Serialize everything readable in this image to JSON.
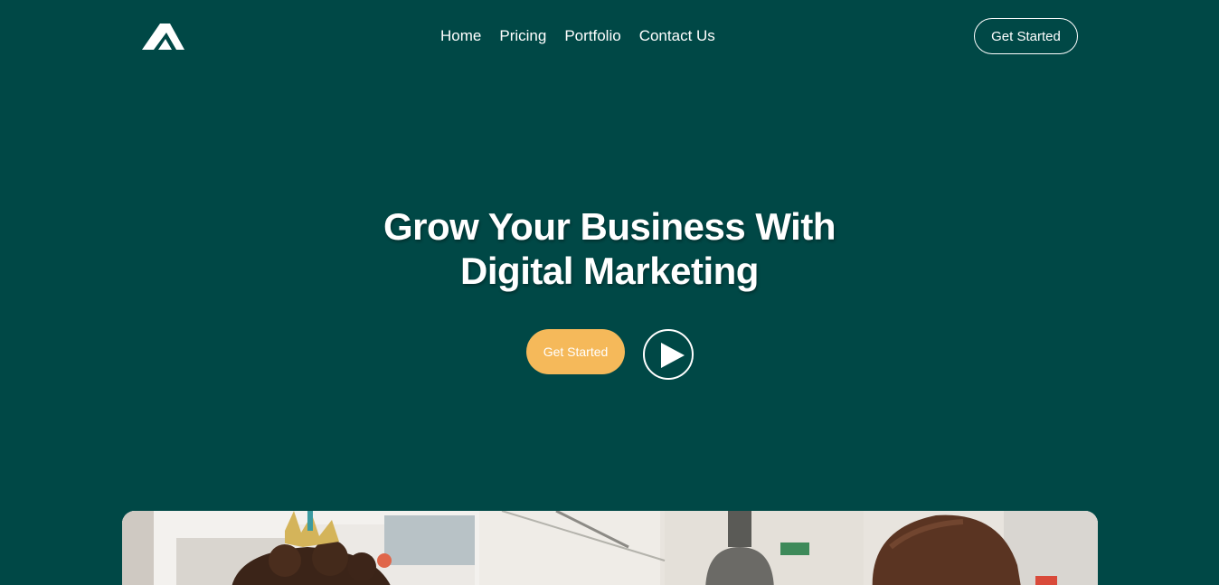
{
  "header": {
    "logo_icon": "triangle-a-logo",
    "nav": [
      {
        "label": "Home"
      },
      {
        "label": "Pricing"
      },
      {
        "label": "Portfolio"
      },
      {
        "label": "Contact Us"
      }
    ],
    "cta_label": "Get Started"
  },
  "hero": {
    "title_line1": "Grow Your Business With",
    "title_line2": "Digital Marketing",
    "cta_label": "Get Started",
    "play_icon": "play-icon"
  },
  "colors": {
    "background": "#004846",
    "accent": "#f5b95a",
    "text": "#ffffff"
  }
}
